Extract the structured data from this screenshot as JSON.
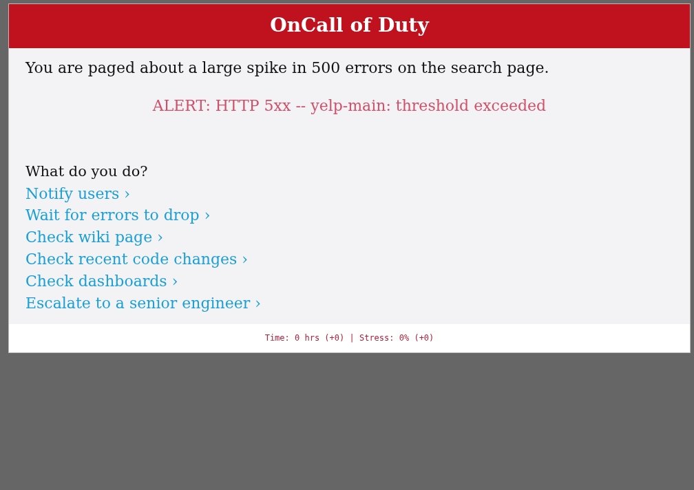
{
  "header": {
    "title": "OnCall of Duty"
  },
  "intro": "You are paged about a large spike in 500 errors on the search page.",
  "alert": "ALERT: HTTP 5xx -- yelp-main: threshold exceeded",
  "question": "What do you do?",
  "choices": [
    {
      "label": "Notify users ›"
    },
    {
      "label": "Wait for errors to drop ›"
    },
    {
      "label": "Check wiki page ›"
    },
    {
      "label": "Check recent code changes ›"
    },
    {
      "label": "Check dashboards ›"
    },
    {
      "label": "Escalate to a senior engineer ›"
    }
  ],
  "status_bar": "Time: 0 hrs (+0) | Stress: 0% (+0)"
}
